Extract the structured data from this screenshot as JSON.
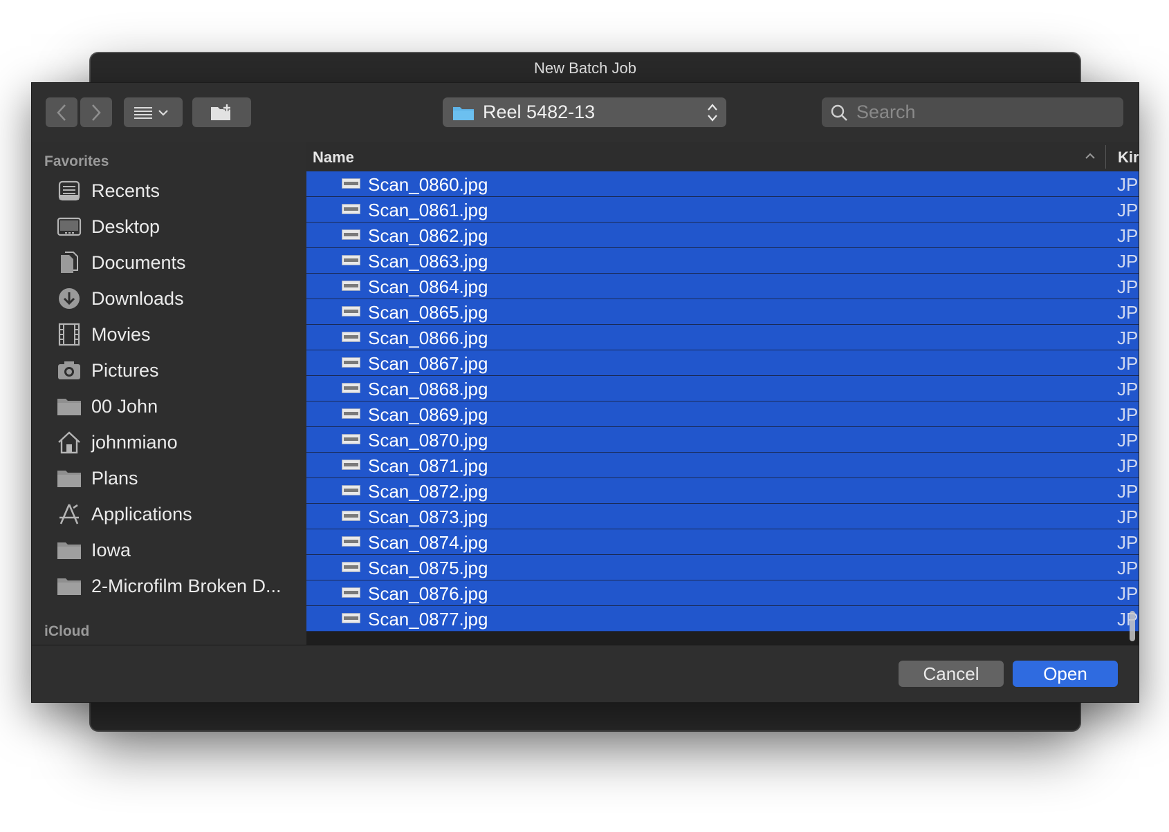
{
  "window": {
    "title": "New Batch Job"
  },
  "toolbar": {
    "path_popup_label": "Reel 5482-13",
    "search_placeholder": "Search"
  },
  "sidebar": {
    "favorites_header": "Favorites",
    "icloud_header": "iCloud",
    "items": [
      {
        "label": "Recents",
        "icon": "recents-icon"
      },
      {
        "label": "Desktop",
        "icon": "desktop-icon"
      },
      {
        "label": "Documents",
        "icon": "documents-icon"
      },
      {
        "label": "Downloads",
        "icon": "downloads-icon"
      },
      {
        "label": "Movies",
        "icon": "movies-icon"
      },
      {
        "label": "Pictures",
        "icon": "pictures-icon"
      },
      {
        "label": "00 John",
        "icon": "folder-icon"
      },
      {
        "label": "johnmiano",
        "icon": "home-icon"
      },
      {
        "label": "Plans",
        "icon": "folder-icon"
      },
      {
        "label": "Applications",
        "icon": "applications-icon"
      },
      {
        "label": "Iowa",
        "icon": "folder-icon"
      },
      {
        "label": "2-Microfilm Broken D...",
        "icon": "folder-icon"
      }
    ]
  },
  "filelist": {
    "columns": {
      "name": "Name",
      "kind": "Kir"
    },
    "rows": [
      {
        "name": "Scan_0860.jpg",
        "kind": "JP"
      },
      {
        "name": "Scan_0861.jpg",
        "kind": "JP"
      },
      {
        "name": "Scan_0862.jpg",
        "kind": "JP"
      },
      {
        "name": "Scan_0863.jpg",
        "kind": "JP"
      },
      {
        "name": "Scan_0864.jpg",
        "kind": "JP"
      },
      {
        "name": "Scan_0865.jpg",
        "kind": "JP"
      },
      {
        "name": "Scan_0866.jpg",
        "kind": "JP"
      },
      {
        "name": "Scan_0867.jpg",
        "kind": "JP"
      },
      {
        "name": "Scan_0868.jpg",
        "kind": "JP"
      },
      {
        "name": "Scan_0869.jpg",
        "kind": "JP"
      },
      {
        "name": "Scan_0870.jpg",
        "kind": "JP"
      },
      {
        "name": "Scan_0871.jpg",
        "kind": "JP"
      },
      {
        "name": "Scan_0872.jpg",
        "kind": "JP"
      },
      {
        "name": "Scan_0873.jpg",
        "kind": "JP"
      },
      {
        "name": "Scan_0874.jpg",
        "kind": "JP"
      },
      {
        "name": "Scan_0875.jpg",
        "kind": "JP"
      },
      {
        "name": "Scan_0876.jpg",
        "kind": "JP"
      },
      {
        "name": "Scan_0877.jpg",
        "kind": "JP"
      }
    ]
  },
  "buttons": {
    "cancel": "Cancel",
    "open": "Open"
  },
  "colors": {
    "selection": "#2156cc",
    "accent_button": "#2f6be0",
    "folder_blue": "#5fb4e8"
  }
}
